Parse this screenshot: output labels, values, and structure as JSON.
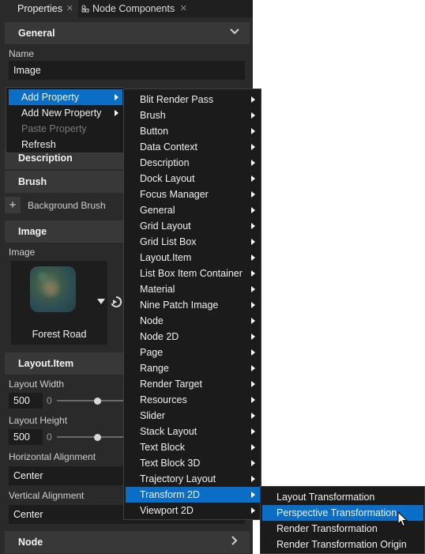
{
  "tabs": {
    "properties": "Properties",
    "node_components": "Node Components",
    "close_glyph": "✕"
  },
  "sections": {
    "general": "General",
    "description": "Description",
    "brush": "Brush",
    "image": "Image",
    "layout_item": "Layout.Item",
    "node": "Node"
  },
  "general": {
    "name_label": "Name",
    "name_value": "Image"
  },
  "brush": {
    "add_glyph": "+",
    "background_brush_label": "Background Brush"
  },
  "image": {
    "image_label": "Image",
    "image_name": "Forest Road"
  },
  "layout": {
    "layout_width_label": "Layout Width",
    "layout_width_value": "500",
    "layout_width_min": "0",
    "layout_height_label": "Layout Height",
    "layout_height_value": "500",
    "layout_height_min": "0",
    "horizontal_alignment_label": "Horizontal Alignment",
    "horizontal_alignment_value": "Center",
    "vertical_alignment_label": "Vertical Alignment",
    "vertical_alignment_value": "Center"
  },
  "context_menu": {
    "items": [
      {
        "label": "Add Property",
        "state": "highlighted",
        "submenu": true
      },
      {
        "label": "Add New Property",
        "state": "normal",
        "submenu": true
      },
      {
        "label": "Paste Property",
        "state": "disabled",
        "submenu": false
      },
      {
        "label": "Refresh",
        "state": "normal",
        "submenu": false
      }
    ]
  },
  "add_property_submenu": {
    "items": [
      "Blit Render Pass",
      "Brush",
      "Button",
      "Data Context",
      "Description",
      "Dock Layout",
      "Focus Manager",
      "General",
      "Grid Layout",
      "Grid List Box",
      "Layout.Item",
      "List Box Item Container",
      "Material",
      "Nine Patch Image",
      "Node",
      "Node 2D",
      "Page",
      "Range",
      "Render Target",
      "Resources",
      "Slider",
      "Stack Layout",
      "Text Block",
      "Text Block 3D",
      "Trajectory Layout",
      "Transform 2D",
      "Viewport 2D"
    ],
    "highlighted": "Transform 2D"
  },
  "transform2d_submenu": {
    "items": [
      "Layout Transformation",
      "Perspective Transformation",
      "Render Transformation",
      "Render Transformation Origin"
    ],
    "highlighted": "Perspective Transformation"
  },
  "colors": {
    "panel_bg": "#2a2a2a",
    "section_header_bg": "#383838",
    "input_bg": "#1c1c1c",
    "menu_bg": "#1b1b1b",
    "highlight": "#0a6ec6"
  },
  "icons": {
    "node_components_tab": "node-components-icon",
    "general_collapse": "chevron-down-icon",
    "node_expand": "chevron-right-icon",
    "submenu_arrow": "caret-right-icon",
    "image_dropdown": "caret-down-icon",
    "image_reset": "reset-arrow-icon",
    "mouse_pointer": "mouse-pointer-icon"
  }
}
